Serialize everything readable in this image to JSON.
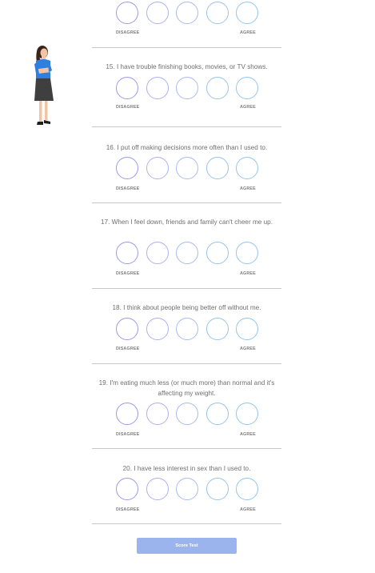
{
  "scale": {
    "disagree_label": "DISAGREE",
    "agree_label": "AGREE",
    "option_count": 5
  },
  "questions": [
    {
      "text": ""
    },
    {
      "text": "15. I have trouble finishing books, movies, or TV shows."
    },
    {
      "text": "16. I put off making decisions more often than I used to."
    },
    {
      "text": "17. When I feel down, friends and family can't cheer me up."
    },
    {
      "text": "18. I think about people being better off without me."
    },
    {
      "text": "19. I'm eating much less (or much more) than normal and it's affecting my weight."
    },
    {
      "text": "20. I have less interest in sex than I used to."
    }
  ],
  "submit": {
    "label": "Score Test"
  },
  "colors": {
    "circle_left": "#9c9aee",
    "circle_right": "#93c6ec",
    "button": "#9cb4ee",
    "divider": "#c9c9c9"
  }
}
